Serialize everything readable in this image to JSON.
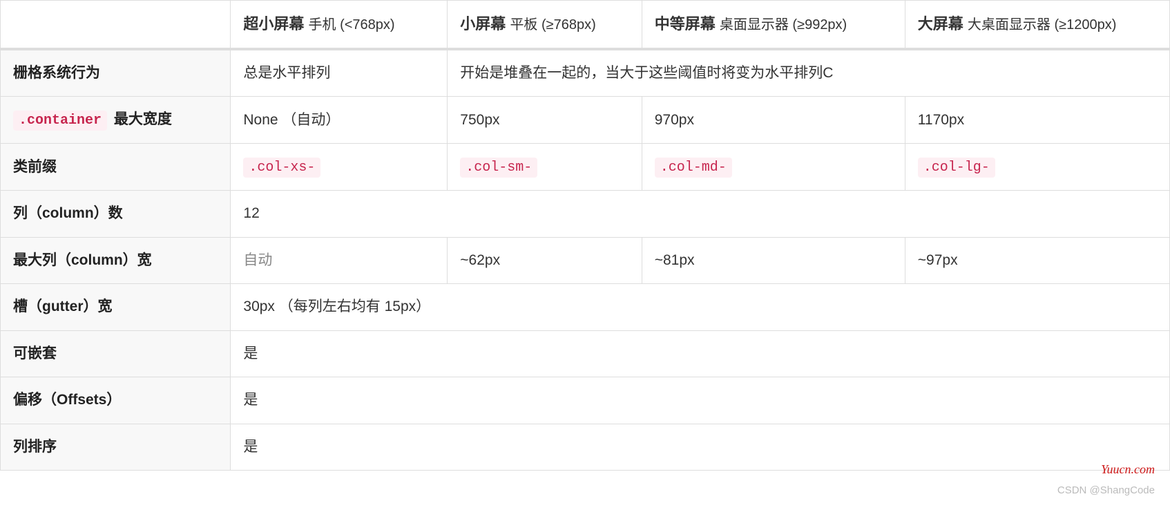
{
  "headers": {
    "blank": "",
    "xs_main": "超小屏幕",
    "xs_sub": "手机 (<768px)",
    "sm_main": "小屏幕",
    "sm_sub": "平板 (≥768px)",
    "md_main": "中等屏幕",
    "md_sub": "桌面显示器 (≥992px)",
    "lg_main": "大屏幕",
    "lg_sub": "大桌面显示器 (≥1200px)"
  },
  "rows": {
    "behavior": {
      "label": "栅格系统行为",
      "xs": "总是水平排列",
      "rest": "开始是堆叠在一起的，当大于这些阈值时将变为水平排列C"
    },
    "container": {
      "code": ".container",
      "label_suffix": "最大宽度",
      "xs": "None （自动）",
      "sm": "750px",
      "md": "970px",
      "lg": "1170px"
    },
    "prefix": {
      "label": "类前缀",
      "xs": ".col-xs-",
      "sm": ".col-sm-",
      "md": ".col-md-",
      "lg": ".col-lg-"
    },
    "columns": {
      "label": "列（column）数",
      "value": "12"
    },
    "maxcol": {
      "label": "最大列（column）宽",
      "xs": "自动",
      "sm": "~62px",
      "md": "~81px",
      "lg": "~97px"
    },
    "gutter": {
      "label": "槽（gutter）宽",
      "value": "30px （每列左右均有 15px）"
    },
    "nestable": {
      "label": "可嵌套",
      "value": "是"
    },
    "offsets": {
      "label": "偏移（Offsets）",
      "value": "是"
    },
    "ordering": {
      "label": "列排序",
      "value": "是"
    }
  },
  "watermarks": {
    "w1": "Yuucn.com",
    "w2": "CSDN @ShangCode"
  }
}
